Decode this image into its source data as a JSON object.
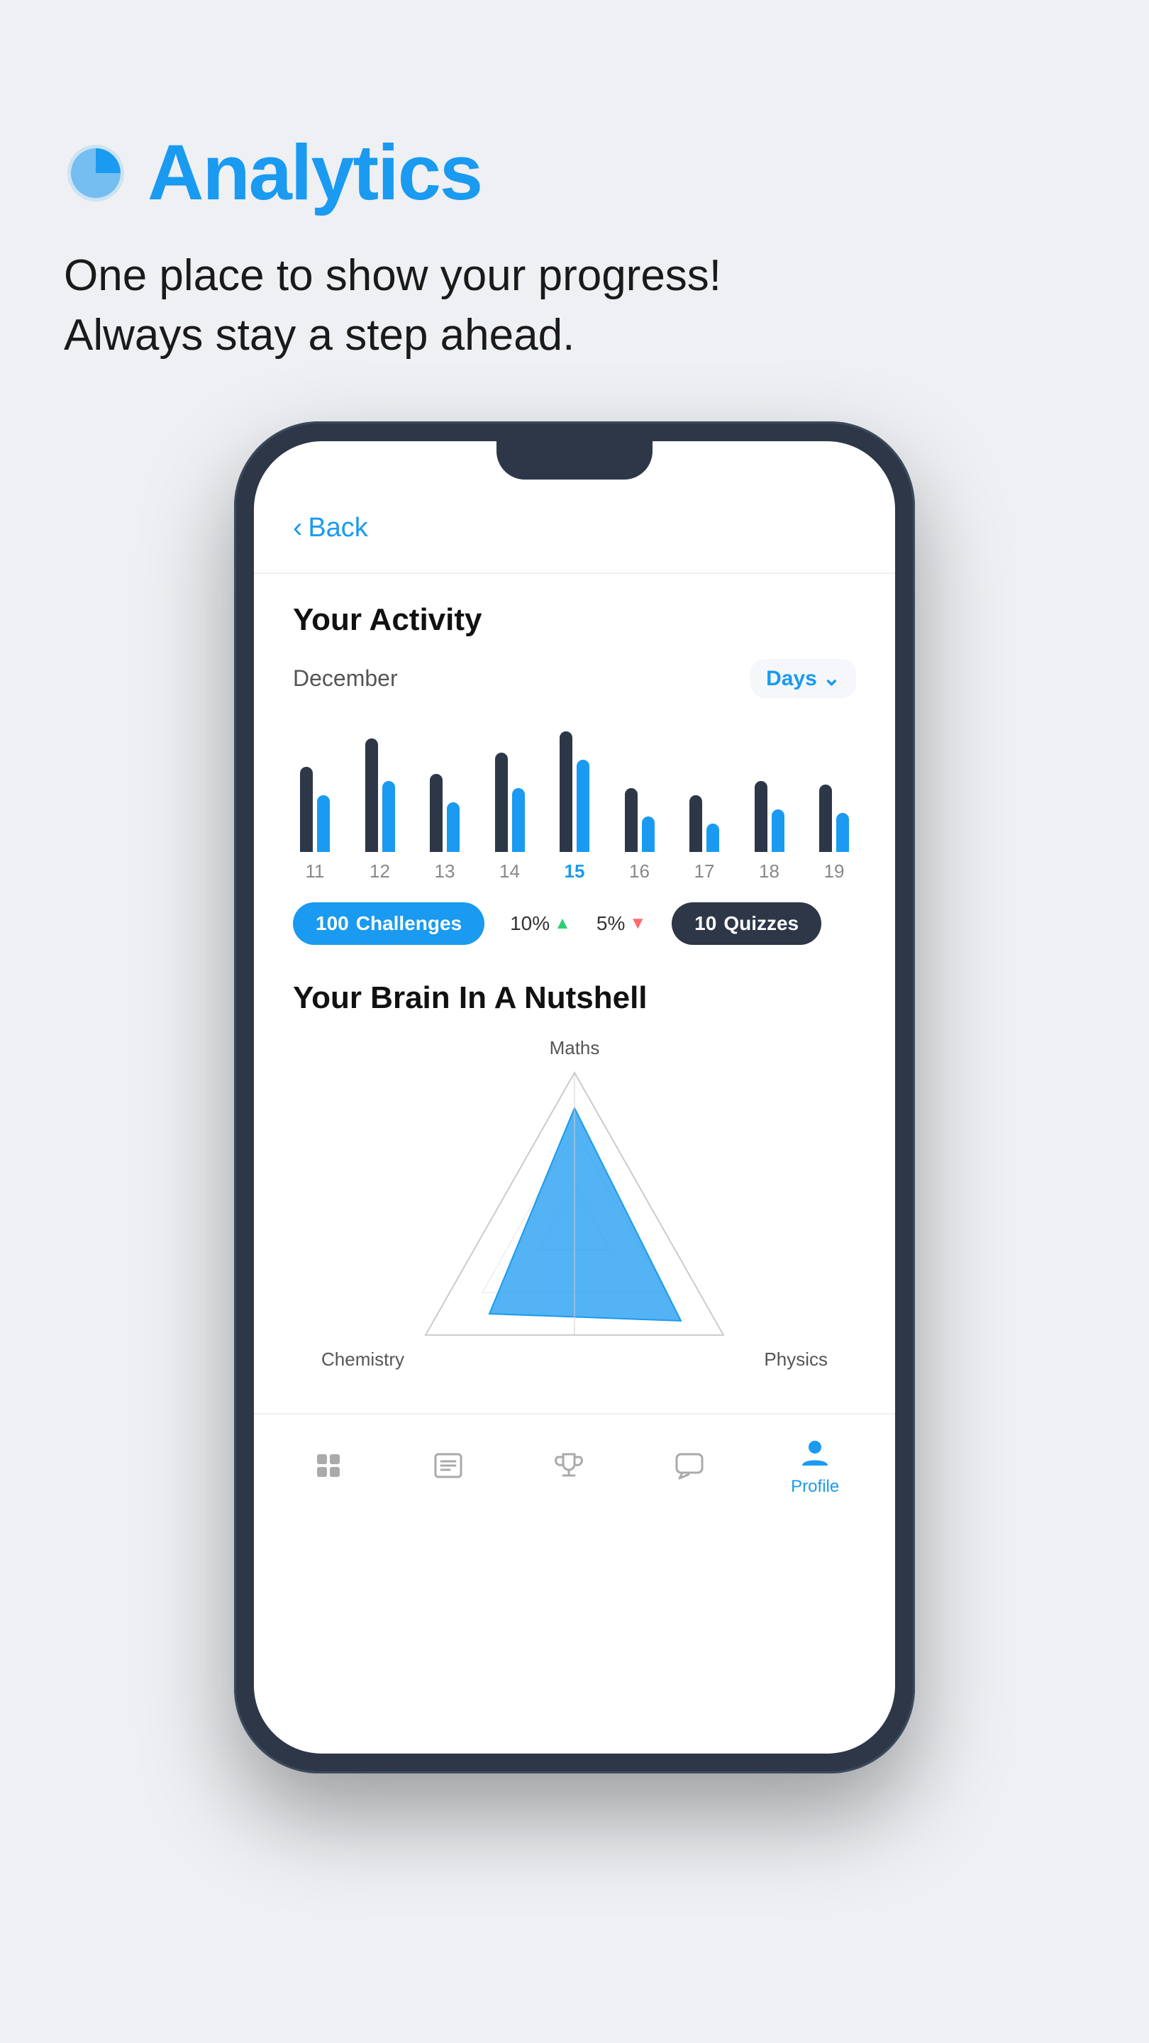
{
  "page": {
    "background_color": "#eef0f3"
  },
  "header": {
    "icon_label": "analytics-pie-icon",
    "title": "Analytics",
    "subtitle_line1": "One place to show your progress!",
    "subtitle_line2": "Always stay a step ahead."
  },
  "phone": {
    "back_button": "Back",
    "screen": {
      "activity": {
        "section_title": "Your Activity",
        "month": "December",
        "filter_label": "Days",
        "bars": [
          {
            "day": "11",
            "dark_height": 120,
            "blue_height": 80,
            "active": false
          },
          {
            "day": "12",
            "dark_height": 160,
            "blue_height": 100,
            "active": false
          },
          {
            "day": "13",
            "dark_height": 110,
            "blue_height": 70,
            "active": false
          },
          {
            "day": "14",
            "dark_height": 140,
            "blue_height": 90,
            "active": false
          },
          {
            "day": "15",
            "dark_height": 170,
            "blue_height": 130,
            "active": true
          },
          {
            "day": "16",
            "dark_height": 90,
            "blue_height": 50,
            "active": false
          },
          {
            "day": "17",
            "dark_height": 80,
            "blue_height": 40,
            "active": false
          },
          {
            "day": "18",
            "dark_height": 100,
            "blue_height": 60,
            "active": false
          },
          {
            "day": "19",
            "dark_height": 95,
            "blue_height": 55,
            "active": false
          }
        ],
        "stats": {
          "challenges": {
            "count": 100,
            "label": "Challenges"
          },
          "percent_up": {
            "value": "10%",
            "direction": "up"
          },
          "percent_down": {
            "value": "5%",
            "direction": "down"
          },
          "quizzes": {
            "count": 10,
            "label": "Quizzes"
          }
        }
      },
      "brain": {
        "section_title": "Your Brain In A Nutshell",
        "labels": {
          "top": "Maths",
          "bottom_left": "Chemistry",
          "bottom_right": "Physics"
        }
      }
    },
    "bottom_nav": {
      "items": [
        {
          "id": "home",
          "label": "",
          "active": false
        },
        {
          "id": "lessons",
          "label": "",
          "active": false
        },
        {
          "id": "trophy",
          "label": "",
          "active": false
        },
        {
          "id": "chat",
          "label": "",
          "active": false
        },
        {
          "id": "profile",
          "label": "Profile",
          "active": true
        }
      ]
    }
  }
}
